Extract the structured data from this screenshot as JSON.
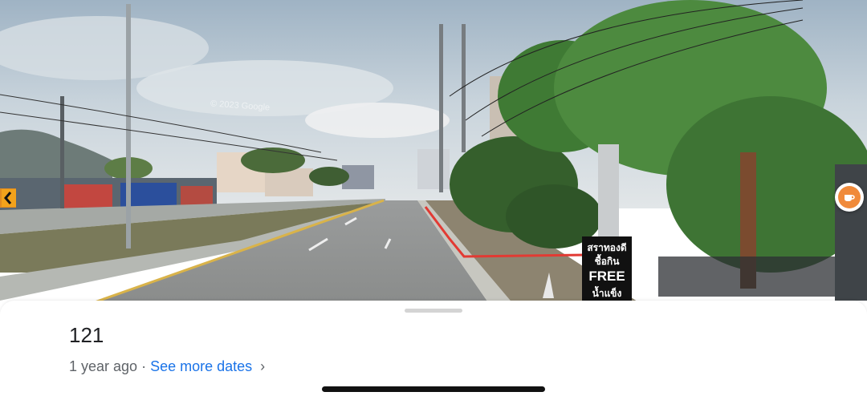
{
  "street_view": {
    "watermark": "© 2023 Google",
    "sign": {
      "line1": "สราทองดี",
      "line2": "ชื้อกิน",
      "line3": "FREE",
      "line4": "น้ำแข็ง"
    },
    "place_marker_icon": "coffee-cup-icon",
    "accent": "#f08a3a"
  },
  "sheet": {
    "title": "121",
    "age": "1 year ago",
    "separator": "·",
    "dates_link": "See more dates",
    "chevron": "›",
    "link_color": "#1a73e8"
  }
}
